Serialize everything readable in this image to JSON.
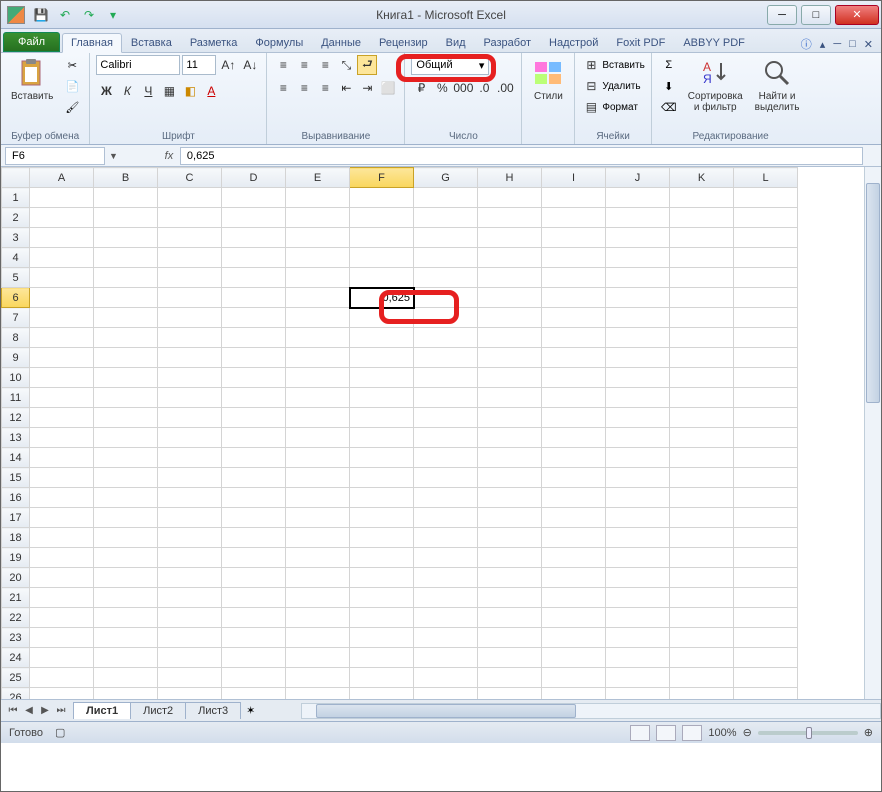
{
  "title": "Книга1  -  Microsoft Excel",
  "qat": {
    "save": "💾",
    "undo": "↶",
    "redo": "↷"
  },
  "tabs": {
    "file": "Файл",
    "items": [
      "Главная",
      "Вставка",
      "Разметка",
      "Формулы",
      "Данные",
      "Рецензир",
      "Вид",
      "Разработ",
      "Надстрой",
      "Foxit PDF",
      "ABBYY PDF"
    ],
    "active": 0
  },
  "ribbon": {
    "clipboard": {
      "paste": "Вставить",
      "label": "Буфер обмена"
    },
    "font": {
      "name": "Calibri",
      "size": "11",
      "label": "Шрифт"
    },
    "align": {
      "label": "Выравнивание"
    },
    "number": {
      "format": "Общий",
      "label": "Число"
    },
    "styles": {
      "btn": "Стили",
      "label": ""
    },
    "cells": {
      "insert": "Вставить",
      "delete": "Удалить",
      "format": "Формат",
      "label": "Ячейки"
    },
    "editing": {
      "sort": "Сортировка\nи фильтр",
      "find": "Найти и\nвыделить",
      "label": "Редактирование"
    }
  },
  "nameBox": "F6",
  "formula": "0,625",
  "columns": [
    "A",
    "B",
    "C",
    "D",
    "E",
    "F",
    "G",
    "H",
    "I",
    "J",
    "K",
    "L"
  ],
  "rows": 27,
  "selectedCell": {
    "col": "F",
    "row": 6,
    "value": "0,625"
  },
  "sheets": {
    "items": [
      "Лист1",
      "Лист2",
      "Лист3"
    ],
    "active": 0
  },
  "status": {
    "ready": "Готово",
    "zoom": "100%"
  }
}
